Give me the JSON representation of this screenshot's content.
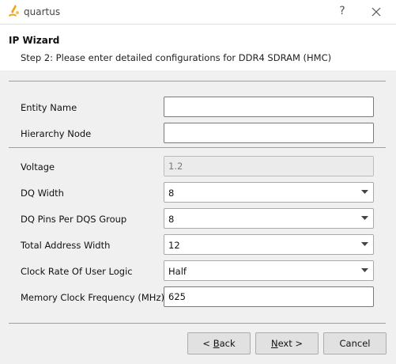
{
  "window": {
    "title": "quartus",
    "help_label": "?"
  },
  "wizard": {
    "title": "IP Wizard",
    "step": "Step 2: Please enter detailed configurations for DDR4 SDRAM (HMC)"
  },
  "fields": {
    "entity_name": {
      "label": "Entity Name",
      "value": ""
    },
    "hierarchy_node": {
      "label": "Hierarchy Node",
      "value": ""
    },
    "voltage": {
      "label": "Voltage",
      "value": "1.2"
    },
    "dq_width": {
      "label": "DQ Width",
      "value": "8"
    },
    "dq_pins_per_dqs": {
      "label": "DQ Pins Per DQS Group",
      "value": "8"
    },
    "total_address_width": {
      "label": "Total Address Width",
      "value": "12"
    },
    "clock_rate_user_logic": {
      "label": "Clock Rate Of User Logic",
      "value": "Half"
    },
    "memory_clock_freq": {
      "label": "Memory Clock Frequency (MHz)",
      "value": "625"
    }
  },
  "buttons": {
    "back": {
      "pre": "< ",
      "mnemonic": "B",
      "post": "ack"
    },
    "next": {
      "pre": "",
      "mnemonic": "N",
      "post": "ext >"
    },
    "cancel": {
      "label": "Cancel"
    }
  },
  "colors": {
    "icon_orange": "#f2a51a",
    "body_bg": "#f0f0f0"
  }
}
